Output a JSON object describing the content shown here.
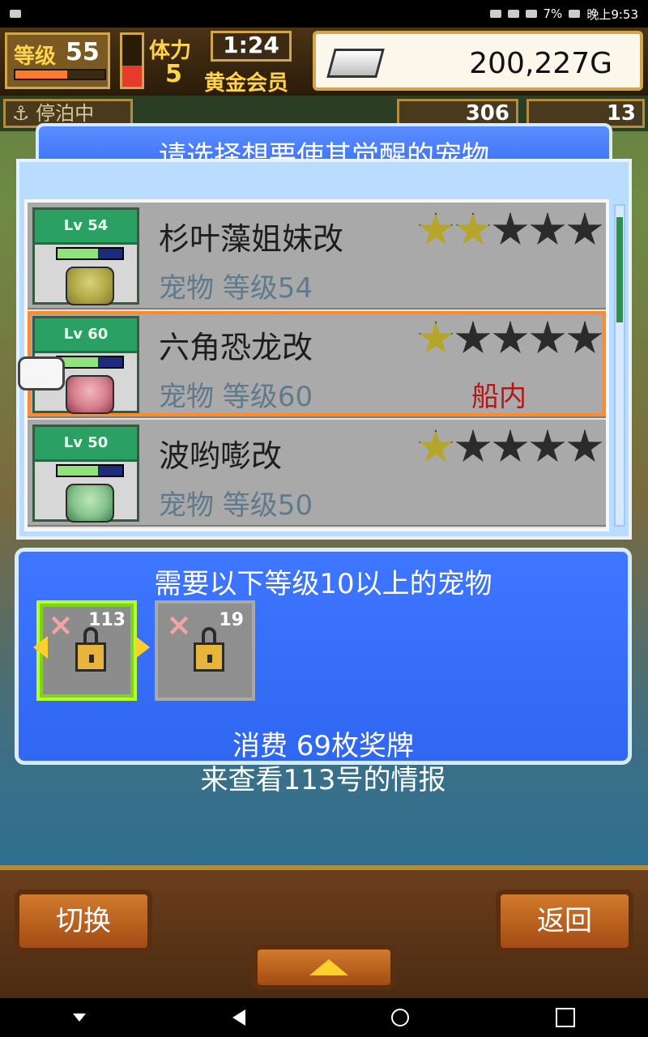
{
  "statusbar": {
    "battery": "7%",
    "time": "晚上9:53"
  },
  "topbar": {
    "level_label": "等级",
    "level_value": "55",
    "level_progress": 0.58,
    "stamina_label": "体力",
    "stamina_value": "5",
    "stamina_fill": 0.4,
    "timer": "1:24",
    "membership": "黄金会员",
    "gold": "200,227G"
  },
  "subbar": {
    "status": "停泊中",
    "count_a": "306",
    "count_b": "13"
  },
  "panel": {
    "title": "请选择想要使其觉醒的宠物"
  },
  "pets": [
    {
      "card_level": "Lv 54",
      "name": "杉叶藻姐妹改",
      "meta": "宠物 等级54",
      "location": "",
      "stars_on": 2,
      "stars_total": 5
    },
    {
      "card_level": "Lv 60",
      "name": "六角恐龙改",
      "meta": "宠物 等级60",
      "location": "船内",
      "stars_on": 1,
      "stars_total": 5
    },
    {
      "card_level": "Lv 50",
      "name": "波哟嘭改",
      "meta": "宠物 等级50",
      "location": "",
      "stars_on": 1,
      "stars_total": 5
    }
  ],
  "requirements": {
    "title": "需要以下等级10以上的宠物",
    "slots": [
      {
        "number": "113"
      },
      {
        "number": "19"
      }
    ],
    "cost": "消费 69枚奖牌",
    "info": "来查看113号的情报"
  },
  "bottom": {
    "switch_label": "切换",
    "back_label": "返回"
  },
  "colors": {
    "accent_orange": "#ff8a2a",
    "panel_blue": "#2f67f2",
    "gold": "#ffd34a"
  }
}
